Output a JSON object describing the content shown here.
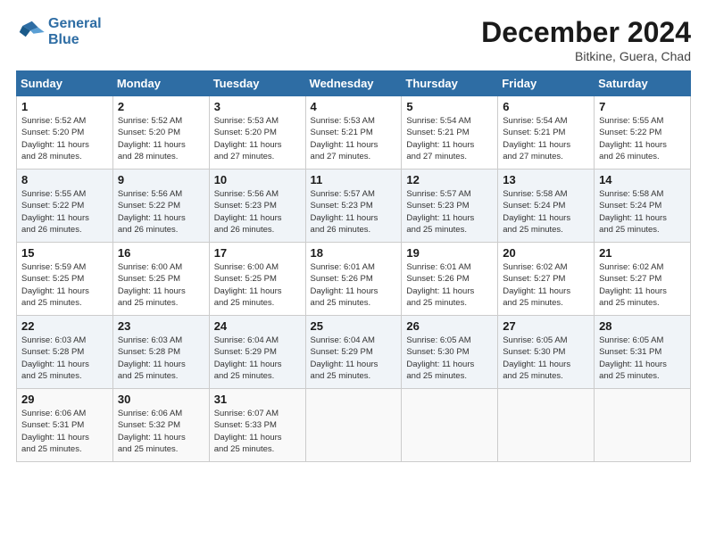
{
  "logo": {
    "line1": "General",
    "line2": "Blue"
  },
  "title": "December 2024",
  "location": "Bitkine, Guera, Chad",
  "weekdays": [
    "Sunday",
    "Monday",
    "Tuesday",
    "Wednesday",
    "Thursday",
    "Friday",
    "Saturday"
  ],
  "weeks": [
    [
      {
        "day": "1",
        "info": "Sunrise: 5:52 AM\nSunset: 5:20 PM\nDaylight: 11 hours\nand 28 minutes."
      },
      {
        "day": "2",
        "info": "Sunrise: 5:52 AM\nSunset: 5:20 PM\nDaylight: 11 hours\nand 28 minutes."
      },
      {
        "day": "3",
        "info": "Sunrise: 5:53 AM\nSunset: 5:20 PM\nDaylight: 11 hours\nand 27 minutes."
      },
      {
        "day": "4",
        "info": "Sunrise: 5:53 AM\nSunset: 5:21 PM\nDaylight: 11 hours\nand 27 minutes."
      },
      {
        "day": "5",
        "info": "Sunrise: 5:54 AM\nSunset: 5:21 PM\nDaylight: 11 hours\nand 27 minutes."
      },
      {
        "day": "6",
        "info": "Sunrise: 5:54 AM\nSunset: 5:21 PM\nDaylight: 11 hours\nand 27 minutes."
      },
      {
        "day": "7",
        "info": "Sunrise: 5:55 AM\nSunset: 5:22 PM\nDaylight: 11 hours\nand 26 minutes."
      }
    ],
    [
      {
        "day": "8",
        "info": "Sunrise: 5:55 AM\nSunset: 5:22 PM\nDaylight: 11 hours\nand 26 minutes."
      },
      {
        "day": "9",
        "info": "Sunrise: 5:56 AM\nSunset: 5:22 PM\nDaylight: 11 hours\nand 26 minutes."
      },
      {
        "day": "10",
        "info": "Sunrise: 5:56 AM\nSunset: 5:23 PM\nDaylight: 11 hours\nand 26 minutes."
      },
      {
        "day": "11",
        "info": "Sunrise: 5:57 AM\nSunset: 5:23 PM\nDaylight: 11 hours\nand 26 minutes."
      },
      {
        "day": "12",
        "info": "Sunrise: 5:57 AM\nSunset: 5:23 PM\nDaylight: 11 hours\nand 25 minutes."
      },
      {
        "day": "13",
        "info": "Sunrise: 5:58 AM\nSunset: 5:24 PM\nDaylight: 11 hours\nand 25 minutes."
      },
      {
        "day": "14",
        "info": "Sunrise: 5:58 AM\nSunset: 5:24 PM\nDaylight: 11 hours\nand 25 minutes."
      }
    ],
    [
      {
        "day": "15",
        "info": "Sunrise: 5:59 AM\nSunset: 5:25 PM\nDaylight: 11 hours\nand 25 minutes."
      },
      {
        "day": "16",
        "info": "Sunrise: 6:00 AM\nSunset: 5:25 PM\nDaylight: 11 hours\nand 25 minutes."
      },
      {
        "day": "17",
        "info": "Sunrise: 6:00 AM\nSunset: 5:25 PM\nDaylight: 11 hours\nand 25 minutes."
      },
      {
        "day": "18",
        "info": "Sunrise: 6:01 AM\nSunset: 5:26 PM\nDaylight: 11 hours\nand 25 minutes."
      },
      {
        "day": "19",
        "info": "Sunrise: 6:01 AM\nSunset: 5:26 PM\nDaylight: 11 hours\nand 25 minutes."
      },
      {
        "day": "20",
        "info": "Sunrise: 6:02 AM\nSunset: 5:27 PM\nDaylight: 11 hours\nand 25 minutes."
      },
      {
        "day": "21",
        "info": "Sunrise: 6:02 AM\nSunset: 5:27 PM\nDaylight: 11 hours\nand 25 minutes."
      }
    ],
    [
      {
        "day": "22",
        "info": "Sunrise: 6:03 AM\nSunset: 5:28 PM\nDaylight: 11 hours\nand 25 minutes."
      },
      {
        "day": "23",
        "info": "Sunrise: 6:03 AM\nSunset: 5:28 PM\nDaylight: 11 hours\nand 25 minutes."
      },
      {
        "day": "24",
        "info": "Sunrise: 6:04 AM\nSunset: 5:29 PM\nDaylight: 11 hours\nand 25 minutes."
      },
      {
        "day": "25",
        "info": "Sunrise: 6:04 AM\nSunset: 5:29 PM\nDaylight: 11 hours\nand 25 minutes."
      },
      {
        "day": "26",
        "info": "Sunrise: 6:05 AM\nSunset: 5:30 PM\nDaylight: 11 hours\nand 25 minutes."
      },
      {
        "day": "27",
        "info": "Sunrise: 6:05 AM\nSunset: 5:30 PM\nDaylight: 11 hours\nand 25 minutes."
      },
      {
        "day": "28",
        "info": "Sunrise: 6:05 AM\nSunset: 5:31 PM\nDaylight: 11 hours\nand 25 minutes."
      }
    ],
    [
      {
        "day": "29",
        "info": "Sunrise: 6:06 AM\nSunset: 5:31 PM\nDaylight: 11 hours\nand 25 minutes."
      },
      {
        "day": "30",
        "info": "Sunrise: 6:06 AM\nSunset: 5:32 PM\nDaylight: 11 hours\nand 25 minutes."
      },
      {
        "day": "31",
        "info": "Sunrise: 6:07 AM\nSunset: 5:33 PM\nDaylight: 11 hours\nand 25 minutes."
      },
      {
        "day": "",
        "info": ""
      },
      {
        "day": "",
        "info": ""
      },
      {
        "day": "",
        "info": ""
      },
      {
        "day": "",
        "info": ""
      }
    ]
  ]
}
